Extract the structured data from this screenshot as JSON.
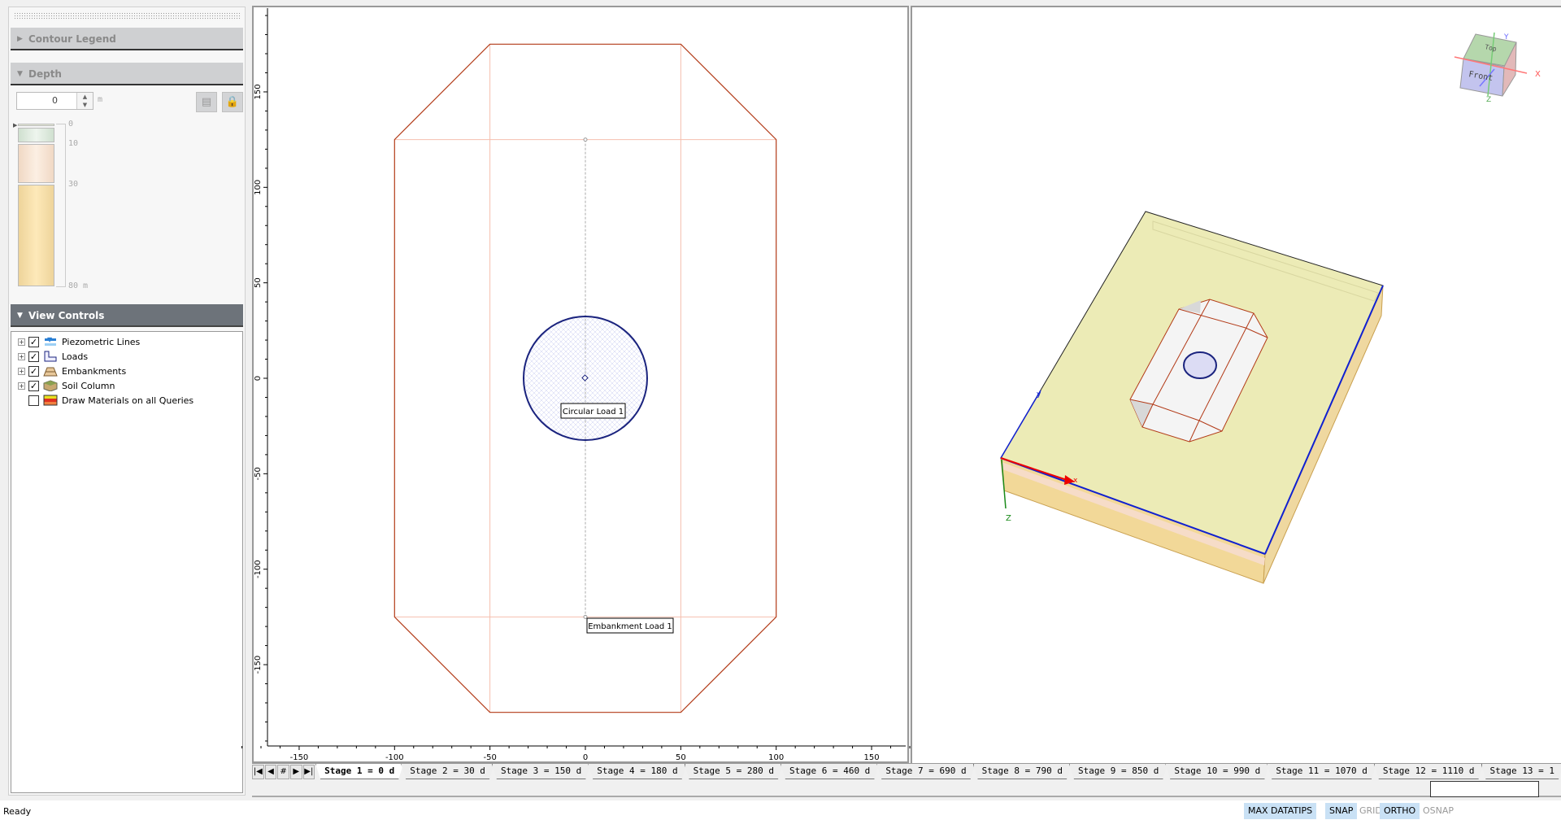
{
  "left_panel": {
    "contour_legend": {
      "title": "Contour Legend",
      "expanded": false
    },
    "depth": {
      "title": "Depth",
      "value": "0",
      "unit": "m",
      "ticks": [
        "0",
        "10",
        "30",
        "80 m"
      ],
      "layer_colors": [
        "#dde9dd",
        "#f6e0cf",
        "#f5dca0"
      ]
    },
    "view_controls": {
      "title": "View Controls",
      "items": [
        {
          "label": "Piezometric Lines",
          "checked": true,
          "icon": "piezometric-icon"
        },
        {
          "label": "Loads",
          "checked": true,
          "icon": "loads-icon"
        },
        {
          "label": "Embankments",
          "checked": true,
          "icon": "embankment-icon"
        },
        {
          "label": "Soil Column",
          "checked": true,
          "icon": "soil-column-icon"
        },
        {
          "label": "Draw Materials on all Queries",
          "checked": false,
          "icon": "materials-icon"
        }
      ]
    }
  },
  "plan_view": {
    "x_ticks": [
      "-150",
      "-100",
      "-50",
      "0",
      "50",
      "100",
      "150"
    ],
    "y_ticks": [
      "150",
      "100",
      "50",
      "0",
      "-50",
      "-100",
      "-150"
    ],
    "labels": {
      "circular_load": "Circular Load 1",
      "embankment_load": "Embankment Load 1"
    },
    "colors": {
      "embankment": "#b23a17",
      "embankment_inner": "#f3b9a6",
      "load": "#1a237e"
    }
  },
  "view_3d": {
    "cube": {
      "top": "Top",
      "front": "Front",
      "x": "X",
      "y": "Y",
      "z": "Z"
    },
    "axis_labels": {
      "z": "Z",
      "x": "x",
      "y": "y"
    }
  },
  "stage_tabs": [
    "Stage 1 = 0 d",
    "Stage 2 = 30 d",
    "Stage 3 = 150 d",
    "Stage 4 = 180 d",
    "Stage 5 = 280 d",
    "Stage 6 = 460 d",
    "Stage 7 = 690 d",
    "Stage 8 = 790 d",
    "Stage 9 = 850 d",
    "Stage 10 = 990 d",
    "Stage 11 = 1070 d",
    "Stage 12 = 1110 d",
    "Stage 13 = 1"
  ],
  "stage_nav": [
    "|◀",
    "◀",
    "#",
    "▶",
    "▶|"
  ],
  "status": {
    "text": "Ready",
    "indicators": [
      {
        "label": "MAX DATATIPS",
        "on": true
      },
      {
        "label": "SNAP",
        "on": true
      },
      {
        "label": "GRID",
        "on": false
      },
      {
        "label": "ORTHO",
        "on": true
      },
      {
        "label": "OSNAP",
        "on": false
      }
    ]
  }
}
